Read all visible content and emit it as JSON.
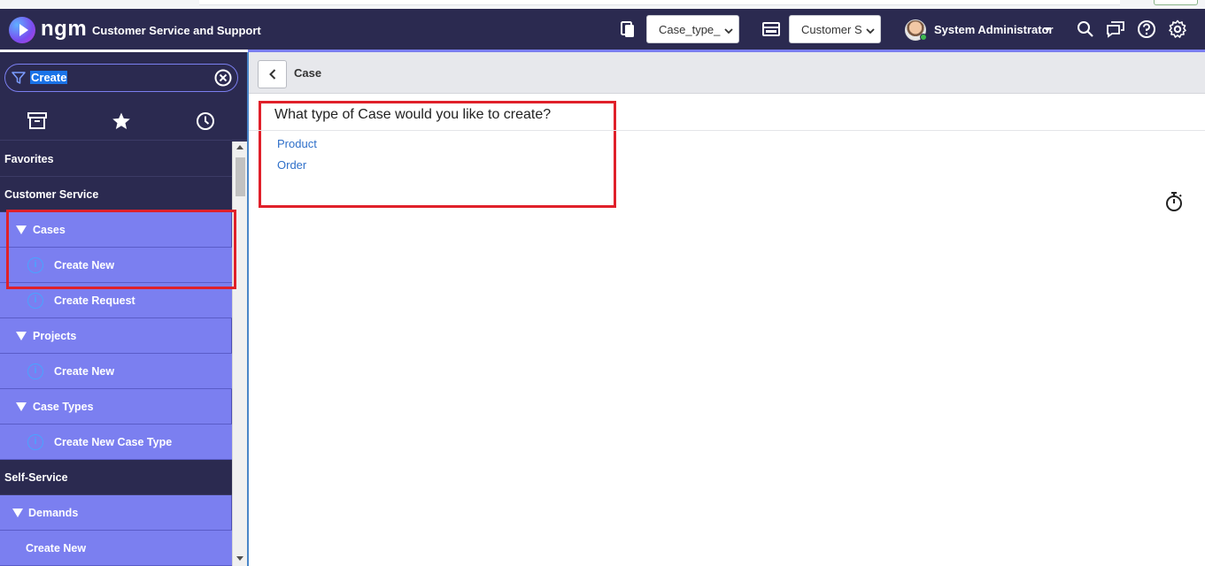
{
  "header": {
    "brand": "ngm",
    "product_name": "Customer Service and Support",
    "scope_select": "Case_type_",
    "app_select": "Customer S",
    "user_name": "System Administrator"
  },
  "sidebar": {
    "filter_value": "Create",
    "items": [
      {
        "kind": "section",
        "label": "Favorites"
      },
      {
        "kind": "section",
        "label": "Customer Service"
      },
      {
        "kind": "group",
        "label": "Cases"
      },
      {
        "kind": "leaf",
        "label": "Create New"
      },
      {
        "kind": "leaf",
        "label": "Create Request"
      },
      {
        "kind": "group",
        "label": "Projects"
      },
      {
        "kind": "leaf",
        "label": "Create New"
      },
      {
        "kind": "group",
        "label": "Case Types"
      },
      {
        "kind": "leaf",
        "label": "Create New Case Type"
      },
      {
        "kind": "section",
        "label": "Self-Service"
      },
      {
        "kind": "group",
        "label": "Demands"
      },
      {
        "kind": "leaf",
        "label": "Create New"
      }
    ]
  },
  "main": {
    "title": "Case",
    "question": "What type of Case would you like to create?",
    "options": [
      "Product",
      "Order"
    ]
  },
  "colors": {
    "header_bg": "#2b2a50",
    "nav_item_bg": "#7b7ff0",
    "link": "#2e6fc9",
    "highlight": "#e0202a"
  }
}
